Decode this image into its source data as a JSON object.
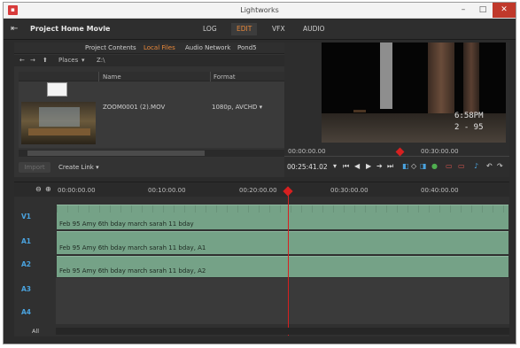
{
  "window": {
    "title": "Lightworks",
    "minimize": "–",
    "maximize": "□",
    "close": "✕"
  },
  "header": {
    "project_name": "Project Home Movie",
    "modes": [
      "LOG",
      "EDIT",
      "VFX",
      "AUDIO"
    ],
    "active_mode": "EDIT"
  },
  "browser": {
    "tabs": [
      "Project Contents",
      "Local Files",
      "Audio Network",
      "Pond5"
    ],
    "active_tab": "Local Files",
    "places_label": "Places",
    "path": "Z:\\",
    "columns": [
      "Name",
      "Format"
    ],
    "file": {
      "name": "ZOOM0001 (2).MOV",
      "format": "1080p, AVCHD"
    },
    "import_label": "Import",
    "create_link_label": "Create Link"
  },
  "viewer": {
    "overlay_time": "6:58PM",
    "overlay_date": "2 - 95",
    "time_start": "00:00:00.00",
    "time_end": "00:30:00.00",
    "timecode": "00:25:41.02"
  },
  "timeline": {
    "ruler": [
      "00:00:00.00",
      "00:10:00.00",
      "00:20:00.00",
      "00:30:00.00",
      "00:40:00.00"
    ],
    "tracks": [
      "V1",
      "A1",
      "A2",
      "A3",
      "A4"
    ],
    "clips": [
      "Feb 95 Amy 6th bday march sarah 11 bday",
      "Feb 95 Amy 6th bday march sarah 11 bday, A1",
      "Feb 95 Amy 6th bday march sarah 11 bday, A2"
    ],
    "all_label": "All"
  }
}
